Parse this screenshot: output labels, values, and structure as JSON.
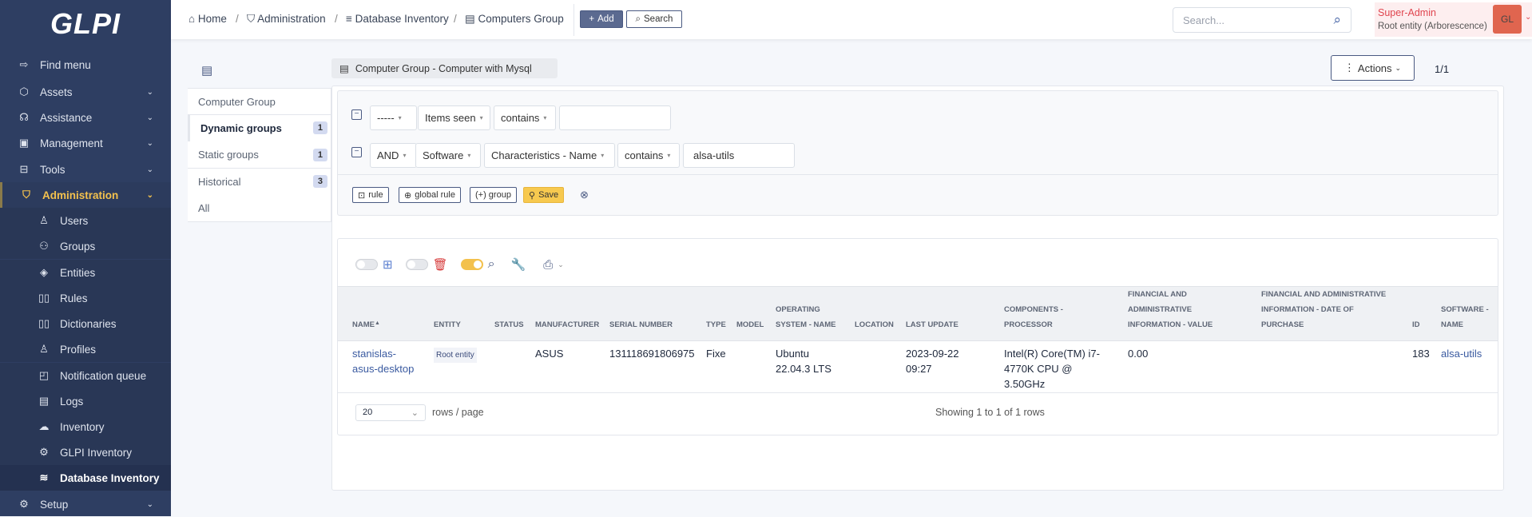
{
  "app": {
    "logo": "GLPI"
  },
  "sidebar": {
    "items": [
      {
        "label": "Find menu",
        "icon": "arrow-right-icon"
      },
      {
        "label": "Assets",
        "icon": "cube-icon"
      },
      {
        "label": "Assistance",
        "icon": "headset-icon"
      },
      {
        "label": "Management",
        "icon": "wallet-icon"
      },
      {
        "label": "Tools",
        "icon": "briefcase-icon"
      },
      {
        "label": "Administration",
        "icon": "shield-icon"
      },
      {
        "label": "Users",
        "icon": "user-icon"
      },
      {
        "label": "Groups",
        "icon": "users-icon"
      },
      {
        "label": "Entities",
        "icon": "layers-icon"
      },
      {
        "label": "Rules",
        "icon": "book-icon"
      },
      {
        "label": "Dictionaries",
        "icon": "book-icon"
      },
      {
        "label": "Profiles",
        "icon": "user-check-icon"
      },
      {
        "label": "Notification queue",
        "icon": "notification-icon"
      },
      {
        "label": "Logs",
        "icon": "news-icon"
      },
      {
        "label": "Inventory",
        "icon": "cloud-download-icon"
      },
      {
        "label": "GLPI Inventory",
        "icon": "gear-icon"
      },
      {
        "label": "Database Inventory",
        "icon": "database-icon"
      },
      {
        "label": "Setup",
        "icon": "gear-icon"
      }
    ]
  },
  "breadcrumb": [
    "Home",
    "Administration",
    "Database Inventory",
    "Computers Group"
  ],
  "header": {
    "add": "Add",
    "search": "Search",
    "search_placeholder": "Search...",
    "profile": "Super-Admin",
    "entity": "Root entity (Arborescence)",
    "avatar": "GL"
  },
  "page": {
    "title": "Computer Group - Computer with Mysql",
    "actions": "Actions",
    "pager": "1/1"
  },
  "tabs": [
    {
      "label": "Computer Group"
    },
    {
      "label": "Dynamic groups",
      "count": "1"
    },
    {
      "label": "Static groups",
      "count": "1"
    },
    {
      "label": "Historical",
      "count": "3"
    },
    {
      "label": "All"
    }
  ],
  "criteria": [
    {
      "link": "-----",
      "field": "Items seen",
      "operator": "contains",
      "value": ""
    },
    {
      "link": "AND",
      "itemtype": "Software",
      "field": "Characteristics - Name",
      "operator": "contains",
      "value": "alsa-utils"
    }
  ],
  "criteria_buttons": {
    "rule": "rule",
    "global_rule": "global rule",
    "group": "(+) group",
    "save": "Save"
  },
  "table": {
    "columns": [
      "Name",
      "Entity",
      "Status",
      "Manufacturer",
      "Serial number",
      "Type",
      "Model",
      "Operating System - Name",
      "Location",
      "Last update",
      "Components - Processor",
      "Financial and administrative information - Value",
      "Financial and administrative information - Date of purchase",
      "ID",
      "Software - Name"
    ],
    "rows": [
      [
        "stanislas-asus-desktop",
        "Root entity",
        "",
        "ASUS",
        "131118691806975",
        "Fixe",
        "",
        "Ubuntu 22.04.3 LTS",
        "",
        "2023-09-22 09:27",
        "Intel(R) Core(TM) i7-4770K CPU @ 3.50GHz",
        "0.00",
        "",
        "183",
        "alsa-utils"
      ]
    ],
    "rows_per_page": "20",
    "rows_per_page_label": "rows / page",
    "summary": "Showing 1 to 1 of 1 rows"
  },
  "colors": {
    "sidebar": "#2e3e62",
    "accent": "#f3c14d",
    "avatar": "#e0654f"
  }
}
